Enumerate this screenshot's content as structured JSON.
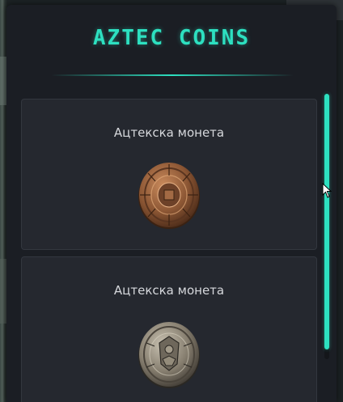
{
  "header": {
    "title": "AZTEC COINS"
  },
  "items": [
    {
      "label": "Ацтекска монета",
      "icon": "bronze-aztec-coin-icon"
    },
    {
      "label": "Ацтекска монета",
      "icon": "silver-aztec-coin-icon"
    }
  ],
  "colors": {
    "accent": "#2de0c0",
    "panel": "#1b1e24",
    "card": "#25282f"
  }
}
